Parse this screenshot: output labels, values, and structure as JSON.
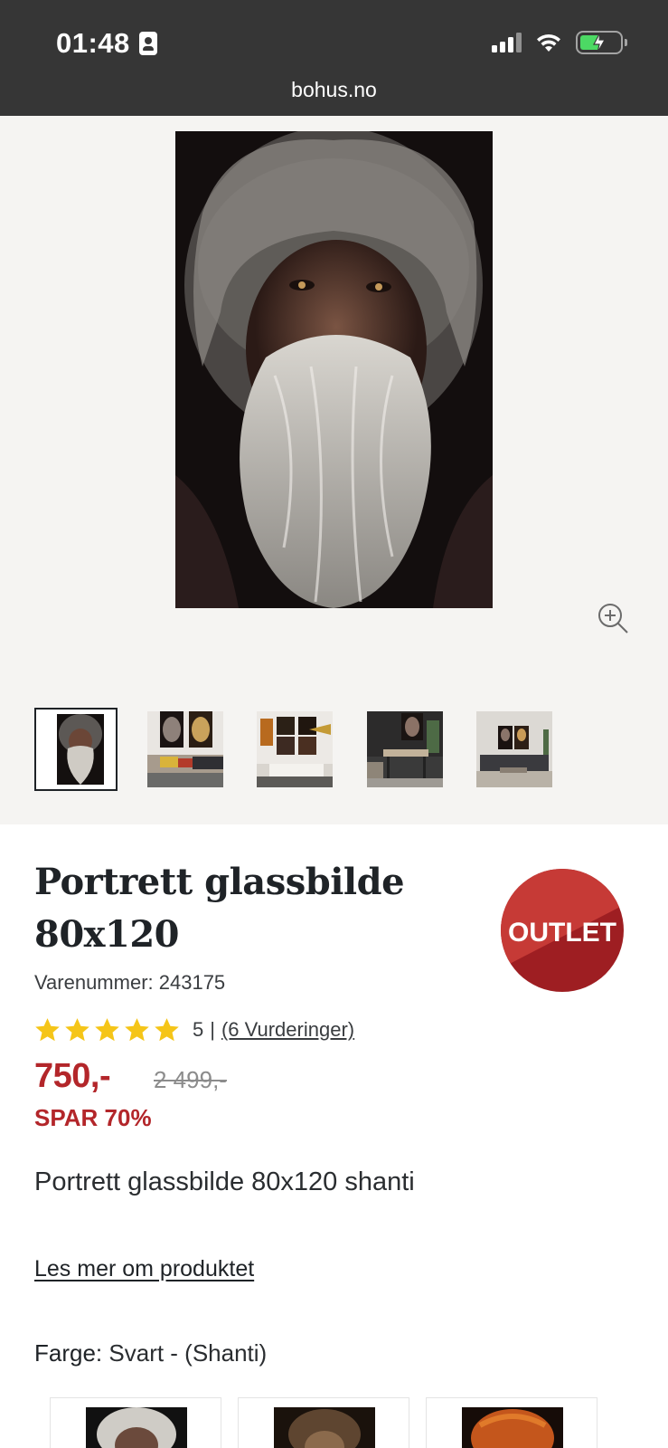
{
  "status_bar": {
    "time": "01:48",
    "url": "bohus.no"
  },
  "product": {
    "title_line1": "Portrett glassbilde",
    "title_line2": "80x120",
    "badge": "OUTLET",
    "sku": "Varenummer: 243175",
    "rating_value": "5",
    "rating_separator": "|",
    "rating_count": "(6 Vurderinger)",
    "rating_stars": 5,
    "price": "750,-",
    "old_price": "2 499,-",
    "savings": "SPAR 70%",
    "description": "Portrett glassbilde 80x120 shanti",
    "read_more": "Les mer om produktet",
    "color_label": "Farge:",
    "color_value": "Svart - (Shanti)"
  },
  "colors": {
    "accent_red": "#b3262a",
    "badge_red": "#c0292e",
    "star_yellow": "#f5c518",
    "status_bar_bg": "#363636",
    "gallery_bg": "#f5f4f2"
  }
}
